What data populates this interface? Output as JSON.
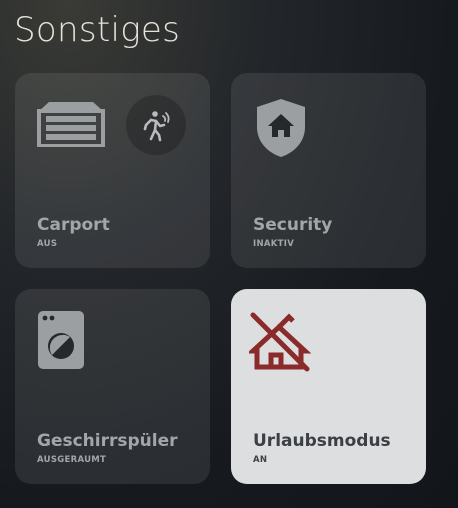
{
  "page": {
    "title": "Sonstiges"
  },
  "tiles": [
    {
      "name": "Carport",
      "state": "AUS",
      "icons": [
        "garage-door-icon",
        "person-walking-motion-icon"
      ]
    },
    {
      "name": "Security",
      "state": "INAKTIV",
      "icons": [
        "shield-home-icon"
      ]
    },
    {
      "name": "Geschirrspüler",
      "state": "AUSGERAUMT",
      "icons": [
        "dishwasher-icon"
      ]
    },
    {
      "name": "Urlaubsmodus",
      "state": "AN",
      "icons": [
        "home-off-icon"
      ]
    }
  ],
  "colors": {
    "active_tile": "#dcdedf",
    "inactive_text": "#a3a6a9",
    "alert_icon": "#8b2a2a"
  }
}
